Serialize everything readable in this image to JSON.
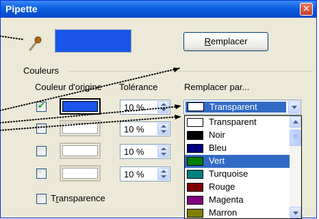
{
  "window": {
    "title": "Pipette",
    "close_glyph": "✕"
  },
  "pipette_icon": "eyedropper-icon",
  "current_color": "#1855e8",
  "replace_button": {
    "label": "Remplacer",
    "underline": "R",
    "rest": "emplacer"
  },
  "group": {
    "label": "Couleurs"
  },
  "headers": {
    "source": "Couleur d'origine",
    "tolerance": "Tolérance",
    "replace": "Remplacer par..."
  },
  "rows": [
    {
      "checked": true,
      "source_color": "#1855e8",
      "tolerance": "10 %"
    },
    {
      "checked": false,
      "source_color": "#ffffff",
      "tolerance": "10 %"
    },
    {
      "checked": false,
      "source_color": "#ffffff",
      "tolerance": "10 %"
    },
    {
      "checked": false,
      "source_color": "#ffffff",
      "tolerance": "10 %"
    }
  ],
  "replace_combo": {
    "selected": "Transparent"
  },
  "color_list": [
    {
      "label": "Transparent",
      "color": "#ffffff"
    },
    {
      "label": "Noir",
      "color": "#000000"
    },
    {
      "label": "Bleu",
      "color": "#000080"
    },
    {
      "label": "Vert",
      "color": "#008000"
    },
    {
      "label": "Turquoise",
      "color": "#008080"
    },
    {
      "label": "Rouge",
      "color": "#800000"
    },
    {
      "label": "Magenta",
      "color": "#800080"
    },
    {
      "label": "Marron",
      "color": "#808000"
    }
  ],
  "highlighted_index": 3,
  "transparence": {
    "label_pre": "T",
    "label_u": "r",
    "label_post": "ansparence",
    "checked": false
  }
}
